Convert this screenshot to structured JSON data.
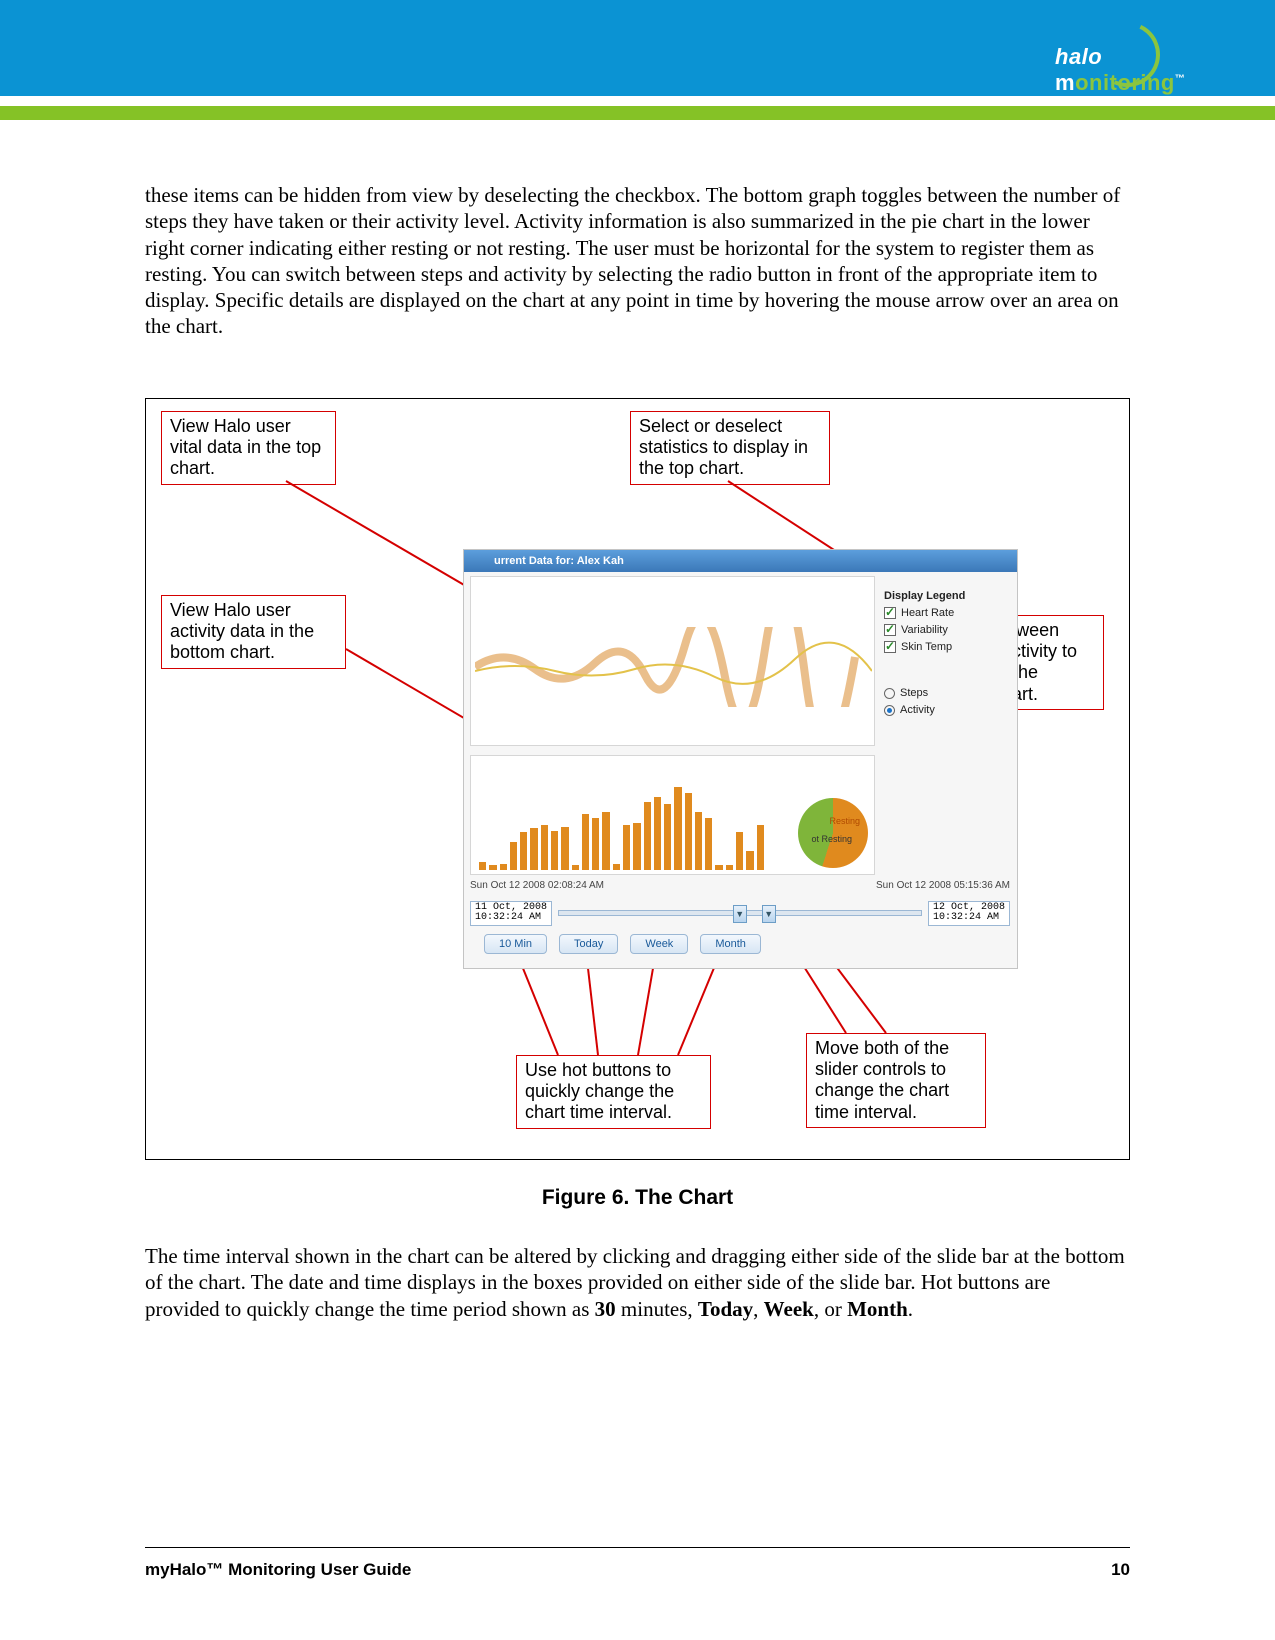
{
  "header": {
    "logo_halo": "halo",
    "logo_on": "onitoring",
    "logo_tm": "™"
  },
  "paragraph1": "these items can be hidden from view by deselecting the checkbox. The bottom graph toggles between the number of steps they have taken or their activity level. Activity information is also summarized in the pie chart in the lower right corner indicating either resting or not resting. The user must be horizontal for the system to register them as resting. You can switch between steps and activity by selecting the radio button in front of the appropriate item to display. Specific details are displayed on the chart at any point in time by hovering the mouse arrow over an area on the chart.",
  "caption": "Figure 6. The Chart",
  "paragraph2_pre": "The time interval shown in the chart can be altered by clicking and dragging either side of the slide bar at the bottom of the chart. The date and time displays in the boxes provided on either side of the slide bar. Hot buttons are provided to quickly change the time period shown as ",
  "paragraph2_b1": "30",
  "paragraph2_m1": " minutes, ",
  "paragraph2_b2": "Today",
  "paragraph2_m2": ", ",
  "paragraph2_b3": "Week",
  "paragraph2_m3": ", or ",
  "paragraph2_b4": "Month",
  "paragraph2_end": ".",
  "callouts": {
    "c1": "View Halo user vital data in the top chart.",
    "c2": "Select or deselect statistics to display in the top chart.",
    "c3": "View Halo user activity data in the bottom chart.",
    "c4": "Toggle between steps or activity to display in the bottom chart.",
    "c5": "Use hot buttons to quickly change the chart time interval.",
    "c6": "Move both of the slider controls to change the chart time interval."
  },
  "chart": {
    "title": "urrent Data for: Alex Kah",
    "legend_header": "Display Legend",
    "legend": [
      {
        "label": "Heart Rate",
        "checked": true
      },
      {
        "label": "Variability",
        "checked": true
      },
      {
        "label": "Skin Temp",
        "checked": true
      }
    ],
    "radios": [
      {
        "label": "Steps",
        "selected": false
      },
      {
        "label": "Activity",
        "selected": true
      }
    ],
    "pie": {
      "resting": "Resting",
      "not_resting": "ot Resting"
    },
    "xaxis_left": "Sun Oct 12 2008 02:08:24 AM",
    "xaxis_right": "Sun Oct 12 2008 05:15:36 AM",
    "date_left": "11 Oct, 2008\n10:32:24 AM",
    "date_right": "12 Oct, 2008\n10:32:24 AM",
    "hot_buttons": [
      "10 Min",
      "Today",
      "Week",
      "Month"
    ]
  },
  "chart_data": {
    "type": "bar",
    "title": "Activity",
    "xlabel": "",
    "ylabel": "",
    "categories": [
      "",
      "",
      "",
      "",
      "",
      "",
      "",
      "",
      "",
      "",
      "",
      "",
      "",
      "",
      "",
      "",
      "",
      "",
      "",
      "",
      "",
      "",
      "",
      "",
      "",
      "",
      "",
      ""
    ],
    "values": [
      8,
      5,
      6,
      30,
      40,
      45,
      48,
      42,
      46,
      5,
      60,
      55,
      62,
      6,
      48,
      50,
      72,
      78,
      70,
      88,
      82,
      62,
      55,
      5,
      5,
      40,
      20,
      48
    ],
    "ylim": [
      0,
      100
    ]
  },
  "footer": {
    "title": "myHalo™ Monitoring User Guide",
    "page": "10"
  }
}
